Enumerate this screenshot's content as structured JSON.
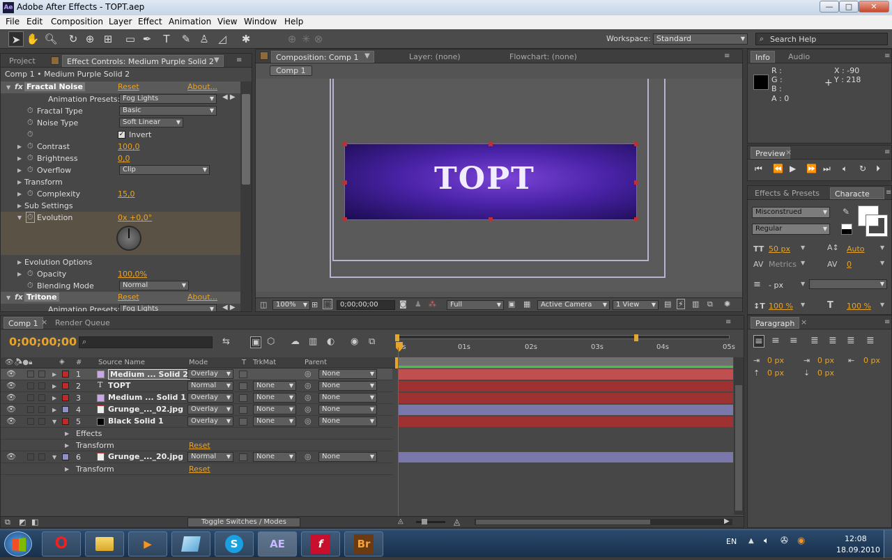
{
  "window": {
    "title": "Adobe After Effects - TOPT.aep",
    "app_icon": "Ae",
    "minimize": "—",
    "maximize": "□",
    "close": "✕"
  },
  "menu": [
    "File",
    "Edit",
    "Composition",
    "Layer",
    "Effect",
    "Animation",
    "View",
    "Window",
    "Help"
  ],
  "workspace": {
    "label": "Workspace:",
    "value": "Standard",
    "search_placeholder": "Search Help"
  },
  "project_panel": {
    "tab_project": "Project",
    "tab_effect": "Effect Controls: Medium Purple Solid 2",
    "breadcrumb": "Comp 1 • Medium Purple Solid 2"
  },
  "effects": {
    "fractal": {
      "name": "Fractal Noise",
      "reset": "Reset",
      "about": "About...",
      "fx": "fx"
    },
    "presets_label": "Animation Presets:",
    "presets_value": "Fog Lights",
    "fractal_type": {
      "label": "Fractal Type",
      "value": "Basic"
    },
    "noise_type": {
      "label": "Noise Type",
      "value": "Soft Linear"
    },
    "invert": {
      "label": "Invert",
      "check": "✓"
    },
    "contrast": {
      "label": "Contrast",
      "value": "100,0"
    },
    "brightness": {
      "label": "Brightness",
      "value": "0,0"
    },
    "overflow": {
      "label": "Overflow",
      "value": "Clip"
    },
    "transform": "Transform",
    "complexity": {
      "label": "Complexity",
      "value": "15,0"
    },
    "sub_settings": "Sub Settings",
    "evolution": {
      "label": "Evolution",
      "value": "0x +0,0°"
    },
    "evolution_options": "Evolution Options",
    "opacity": {
      "label": "Opacity",
      "value": "100,0%"
    },
    "blending": {
      "label": "Blending Mode",
      "value": "Normal"
    },
    "tritone": {
      "name": "Tritone",
      "reset": "Reset",
      "about": "About...",
      "fx": "fx"
    },
    "presets2_value": "Fog Lights"
  },
  "comp_panel": {
    "tab": "Composition: Comp 1",
    "layer_tab": "Layer: (none)",
    "flow_tab": "Flowchart: (none)",
    "comp_btn": "Comp 1",
    "canvas_text": "TOPT",
    "zoom": "100%",
    "timecode": "0;00;00;00",
    "resolution": "Full",
    "camera": "Active Camera",
    "view": "1 View"
  },
  "info": {
    "tab": "Info",
    "audio_tab": "Audio",
    "r": "R :",
    "g": "G :",
    "b": "B :",
    "a": "A : 0",
    "x": "X : -90",
    "y": "Y : 218"
  },
  "preview": {
    "tab": "Preview",
    "close": "×"
  },
  "character": {
    "tab_effects": "Effects & Presets",
    "tab_char": "Characte",
    "font": "Misconstrued",
    "style": "Regular",
    "size": "50 px",
    "leading": "Auto",
    "kerning": "Metrics",
    "tracking": "0",
    "stroke": "- px",
    "vscale": "100 %",
    "hscale": "100 %"
  },
  "paragraph": {
    "tab": "Paragraph",
    "close": "×",
    "indent1": "0 px",
    "indent2": "0 px",
    "indent3": "0 px",
    "space1": "0 px",
    "space2": "0 px"
  },
  "timeline": {
    "tab": "Comp 1",
    "close": "×",
    "render_tab": "Render Queue",
    "timecode": "0;00;00;00",
    "ruler": [
      "0s",
      "01s",
      "02s",
      "03s",
      "04s",
      "05s"
    ],
    "cols": {
      "num": "#",
      "source": "Source Name",
      "mode": "Mode",
      "t": "T",
      "trkmat": "TrkMat",
      "parent": "Parent"
    },
    "layers": [
      {
        "num": "1",
        "name": "Medium ... Solid 2",
        "mode": "Overlay",
        "trk": "",
        "parent": "None",
        "color": "#c8a8e8",
        "label": "#c22a2a",
        "bar": "#c05050"
      },
      {
        "num": "2",
        "name": "TOPT",
        "mode": "Normal",
        "trk": "None",
        "parent": "None",
        "color": "text",
        "label": "#c22a2a",
        "bar": "#9e3232"
      },
      {
        "num": "3",
        "name": "Medium ... Solid 1",
        "mode": "Overlay",
        "trk": "None",
        "parent": "None",
        "color": "#c8a8e8",
        "label": "#c22a2a",
        "bar": "#9e3232"
      },
      {
        "num": "4",
        "name": "Grunge_..._02.jpg",
        "mode": "Overlay",
        "trk": "None",
        "parent": "None",
        "color": "img",
        "label": "#9090c8",
        "bar": "#7a78aa"
      },
      {
        "num": "5",
        "name": "Black Solid 1",
        "mode": "Overlay",
        "trk": "None",
        "parent": "None",
        "color": "#000000",
        "label": "#c22a2a",
        "bar": "#9e3232"
      },
      {
        "num": "6",
        "name": "Grunge_..._20.jpg",
        "mode": "Normal",
        "trk": "None",
        "parent": "None",
        "color": "img",
        "label": "#9090c8",
        "bar": "#7a78aa"
      }
    ],
    "effects_label": "Effects",
    "transform_label": "Transform",
    "reset": "Reset",
    "transform2": "Transform",
    "reset2": "Reset",
    "toggle": "Toggle Switches / Modes"
  },
  "taskbar": {
    "lang": "EN",
    "time": "12:08",
    "date": "18.09.2010",
    "apps": [
      "O",
      "",
      "▶",
      "",
      "S",
      "AE",
      "f",
      "Br"
    ]
  }
}
